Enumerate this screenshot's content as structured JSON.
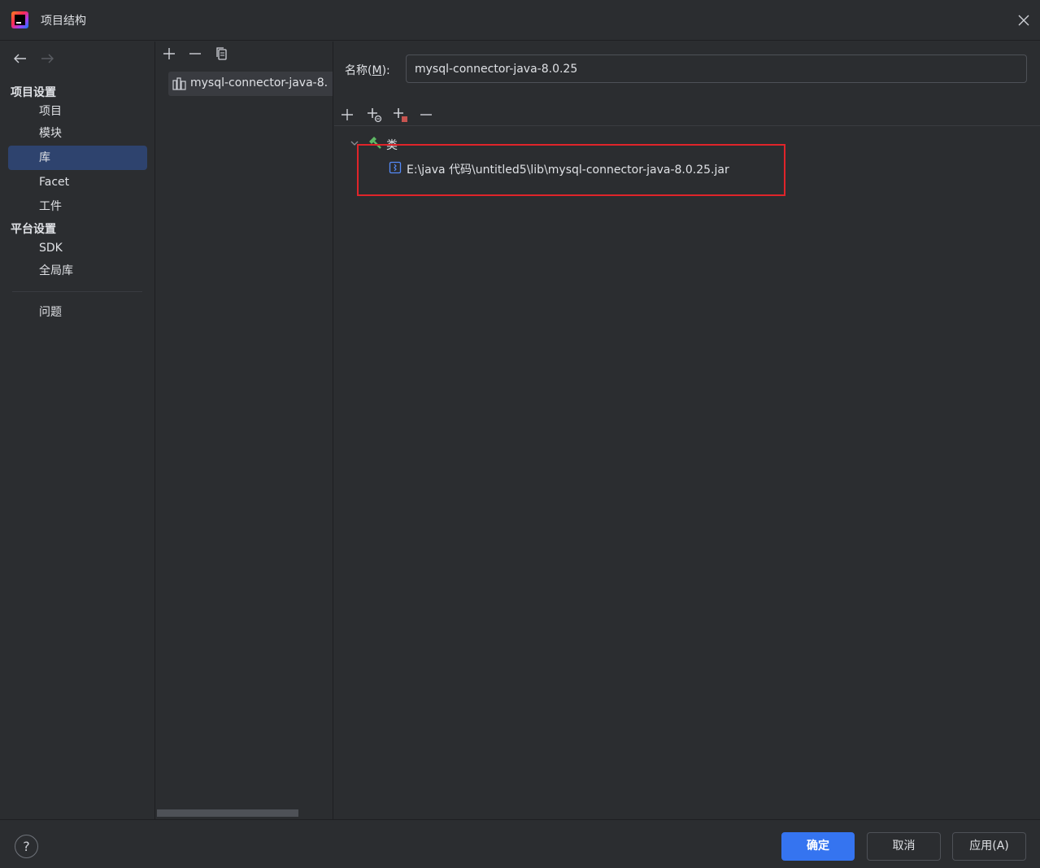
{
  "window": {
    "title": "项目结构",
    "close_icon": "close-icon",
    "app_icon": "intellij-idea-logo-icon"
  },
  "sidebar": {
    "back_icon": "arrow-left-icon",
    "forward_icon": "arrow-right-icon",
    "project_settings_header": "项目设置",
    "project_items": [
      {
        "label": "项目"
      },
      {
        "label": "模块"
      },
      {
        "label": "库"
      },
      {
        "label": "Facet"
      },
      {
        "label": "工件"
      }
    ],
    "platform_settings_header": "平台设置",
    "platform_items": [
      {
        "label": "SDK"
      },
      {
        "label": "全局库"
      }
    ],
    "problems_label": "问题",
    "selected": "库"
  },
  "library_list": {
    "toolbar": [
      "add-icon",
      "remove-icon",
      "copy-icon"
    ],
    "items": [
      {
        "label": "mysql-connector-java-8.",
        "icon": "library-icon"
      }
    ]
  },
  "detail": {
    "name_label_prefix": "名称(",
    "name_label_mnemonic": "M",
    "name_label_suffix": "):",
    "name_value": "mysql-connector-java-8.0.25",
    "toolbar": [
      "add-icon",
      "add-url-icon",
      "add-jar-icon",
      "remove-icon"
    ],
    "tree": {
      "classes_label": "类",
      "classes_icon": "hammer-icon",
      "jar_path": "E:\\java 代码\\untitled5\\lib\\mysql-connector-java-8.0.25.jar",
      "jar_icon": "jar-file-icon"
    },
    "highlight_color": "#e0242a"
  },
  "footer": {
    "help_label": "?",
    "ok_label": "确定",
    "cancel_label": "取消",
    "apply_label": "应用(A)"
  },
  "colors": {
    "background": "#2b2d30",
    "selection": "#2e436e",
    "primary_button": "#3574f0",
    "text": "#dfe1e5"
  }
}
